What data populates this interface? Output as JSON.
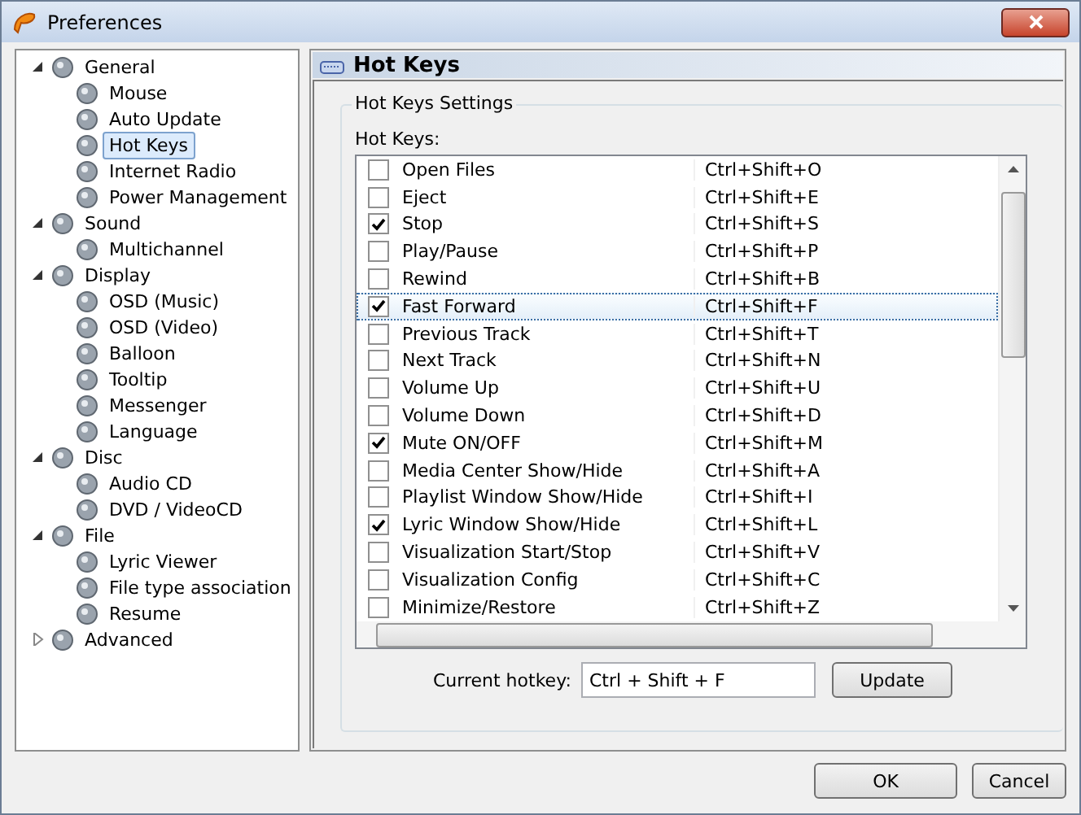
{
  "window": {
    "title": "Preferences"
  },
  "sidebar": {
    "items": [
      {
        "label": "General",
        "expanded": true,
        "selected": false,
        "children": [
          {
            "label": "Mouse",
            "selected": false
          },
          {
            "label": "Auto Update",
            "selected": false
          },
          {
            "label": "Hot Keys",
            "selected": true
          },
          {
            "label": "Internet Radio",
            "selected": false
          },
          {
            "label": "Power Management",
            "selected": false
          }
        ]
      },
      {
        "label": "Sound",
        "expanded": true,
        "selected": false,
        "children": [
          {
            "label": "Multichannel",
            "selected": false
          }
        ]
      },
      {
        "label": "Display",
        "expanded": true,
        "selected": false,
        "children": [
          {
            "label": "OSD (Music)",
            "selected": false
          },
          {
            "label": "OSD (Video)",
            "selected": false
          },
          {
            "label": "Balloon",
            "selected": false
          },
          {
            "label": "Tooltip",
            "selected": false
          },
          {
            "label": "Messenger",
            "selected": false
          },
          {
            "label": "Language",
            "selected": false
          }
        ]
      },
      {
        "label": "Disc",
        "expanded": true,
        "selected": false,
        "children": [
          {
            "label": "Audio CD",
            "selected": false
          },
          {
            "label": "DVD / VideoCD",
            "selected": false
          }
        ]
      },
      {
        "label": "File",
        "expanded": true,
        "selected": false,
        "children": [
          {
            "label": "Lyric Viewer",
            "selected": false
          },
          {
            "label": "File type association",
            "selected": false
          },
          {
            "label": "Resume",
            "selected": false
          }
        ]
      },
      {
        "label": "Advanced",
        "expanded": false,
        "selected": false
      }
    ]
  },
  "panel": {
    "title": "Hot Keys",
    "group_title": "Hot Keys Settings",
    "list_label": "Hot Keys:",
    "hotkeys": [
      {
        "action": "Open Files",
        "keys": "Ctrl+Shift+O",
        "checked": false,
        "selected": false
      },
      {
        "action": "Eject",
        "keys": "Ctrl+Shift+E",
        "checked": false,
        "selected": false
      },
      {
        "action": "Stop",
        "keys": "Ctrl+Shift+S",
        "checked": true,
        "selected": false
      },
      {
        "action": "Play/Pause",
        "keys": "Ctrl+Shift+P",
        "checked": false,
        "selected": false
      },
      {
        "action": "Rewind",
        "keys": "Ctrl+Shift+B",
        "checked": false,
        "selected": false
      },
      {
        "action": "Fast Forward",
        "keys": "Ctrl+Shift+F",
        "checked": true,
        "selected": true
      },
      {
        "action": "Previous Track",
        "keys": "Ctrl+Shift+T",
        "checked": false,
        "selected": false
      },
      {
        "action": "Next Track",
        "keys": "Ctrl+Shift+N",
        "checked": false,
        "selected": false
      },
      {
        "action": "Volume Up",
        "keys": "Ctrl+Shift+U",
        "checked": false,
        "selected": false
      },
      {
        "action": "Volume Down",
        "keys": "Ctrl+Shift+D",
        "checked": false,
        "selected": false
      },
      {
        "action": "Mute ON/OFF",
        "keys": "Ctrl+Shift+M",
        "checked": true,
        "selected": false
      },
      {
        "action": "Media Center Show/Hide",
        "keys": "Ctrl+Shift+A",
        "checked": false,
        "selected": false
      },
      {
        "action": "Playlist Window Show/Hide",
        "keys": "Ctrl+Shift+I",
        "checked": false,
        "selected": false
      },
      {
        "action": "Lyric Window Show/Hide",
        "keys": "Ctrl+Shift+L",
        "checked": true,
        "selected": false
      },
      {
        "action": "Visualization Start/Stop",
        "keys": "Ctrl+Shift+V",
        "checked": false,
        "selected": false
      },
      {
        "action": "Visualization Config",
        "keys": "Ctrl+Shift+C",
        "checked": false,
        "selected": false
      },
      {
        "action": "Minimize/Restore",
        "keys": "Ctrl+Shift+Z",
        "checked": false,
        "selected": false
      }
    ],
    "current_hotkey": {
      "label": "Current hotkey:",
      "value": "Ctrl + Shift + F"
    },
    "update_button": "Update"
  },
  "buttons": [
    "OK",
    "Cancel"
  ]
}
